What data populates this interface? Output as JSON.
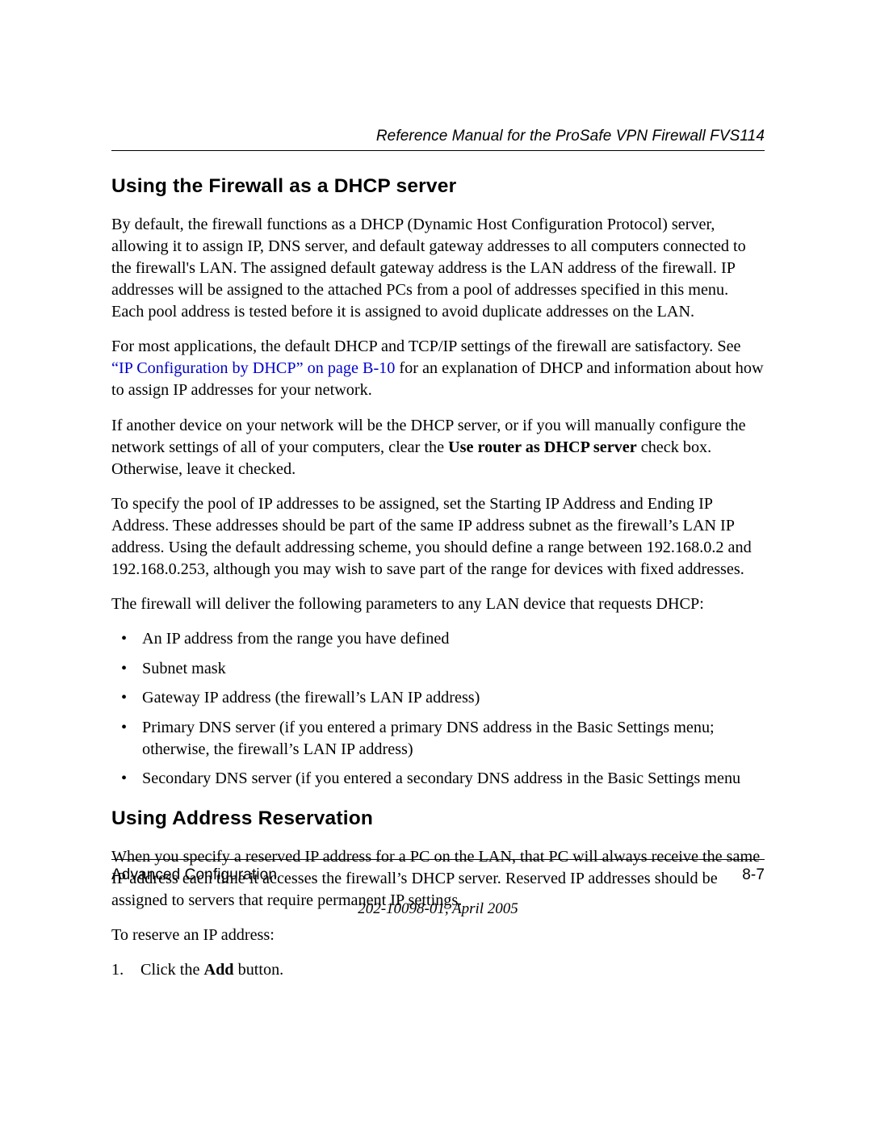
{
  "header": {
    "running_title": "Reference Manual for the ProSafe VPN Firewall FVS114"
  },
  "sections": {
    "dhcp": {
      "heading": "Using the Firewall as a DHCP server",
      "p1": "By default, the firewall functions as a DHCP (Dynamic Host Configuration Protocol) server, allowing it to assign IP, DNS server, and default gateway addresses to all computers connected to the firewall's LAN. The assigned default gateway address is the LAN address of the firewall. IP addresses will be assigned to the attached PCs from a pool of addresses specified in this menu. Each pool address is tested before it is assigned to avoid duplicate addresses on the LAN.",
      "p2a": "For most applications, the default DHCP and TCP/IP settings of the firewall are satisfactory. See ",
      "p2_link": "“IP Configuration by DHCP” on page B-10",
      "p2b": " for an explanation of DHCP and information about how to assign IP addresses for your network.",
      "p3a": "If another device on your network will be the DHCP server, or if you will manually configure the network settings of all of your computers, clear the ",
      "p3_bold": "Use router as DHCP server",
      "p3b": " check box. Otherwise, leave it checked.",
      "p4": "To specify the pool of IP addresses to be assigned, set the Starting IP Address and Ending IP Address. These addresses should be part of the same IP address subnet as the firewall’s LAN IP address. Using the default addressing scheme, you should define a range between 192.168.0.2 and 192.168.0.253, although you may wish to save part of the range for devices with fixed addresses.",
      "p5": "The firewall will deliver the following parameters to any LAN device that requests DHCP:",
      "bullets": [
        "An IP address from the range you have defined",
        "Subnet mask",
        "Gateway IP address (the firewall’s LAN IP address)",
        "Primary DNS server (if you entered a primary DNS address in the Basic Settings menu; otherwise, the firewall’s LAN IP address)",
        "Secondary DNS server (if you entered a secondary DNS address in the Basic Settings menu"
      ]
    },
    "reservation": {
      "heading": "Using Address Reservation",
      "p1": "When you specify a reserved IP address for a PC on the LAN, that PC will always receive the same IP address each time it accesses the firewall’s DHCP server. Reserved IP addresses should be assigned to servers that require permanent IP settings.",
      "p2": "To reserve an IP address:",
      "step1a": "Click the ",
      "step1_bold": "Add",
      "step1b": " button."
    }
  },
  "footer": {
    "chapter": "Advanced Configuration",
    "page_num": "8-7",
    "doc_id": "202-10098-01, April 2005"
  }
}
